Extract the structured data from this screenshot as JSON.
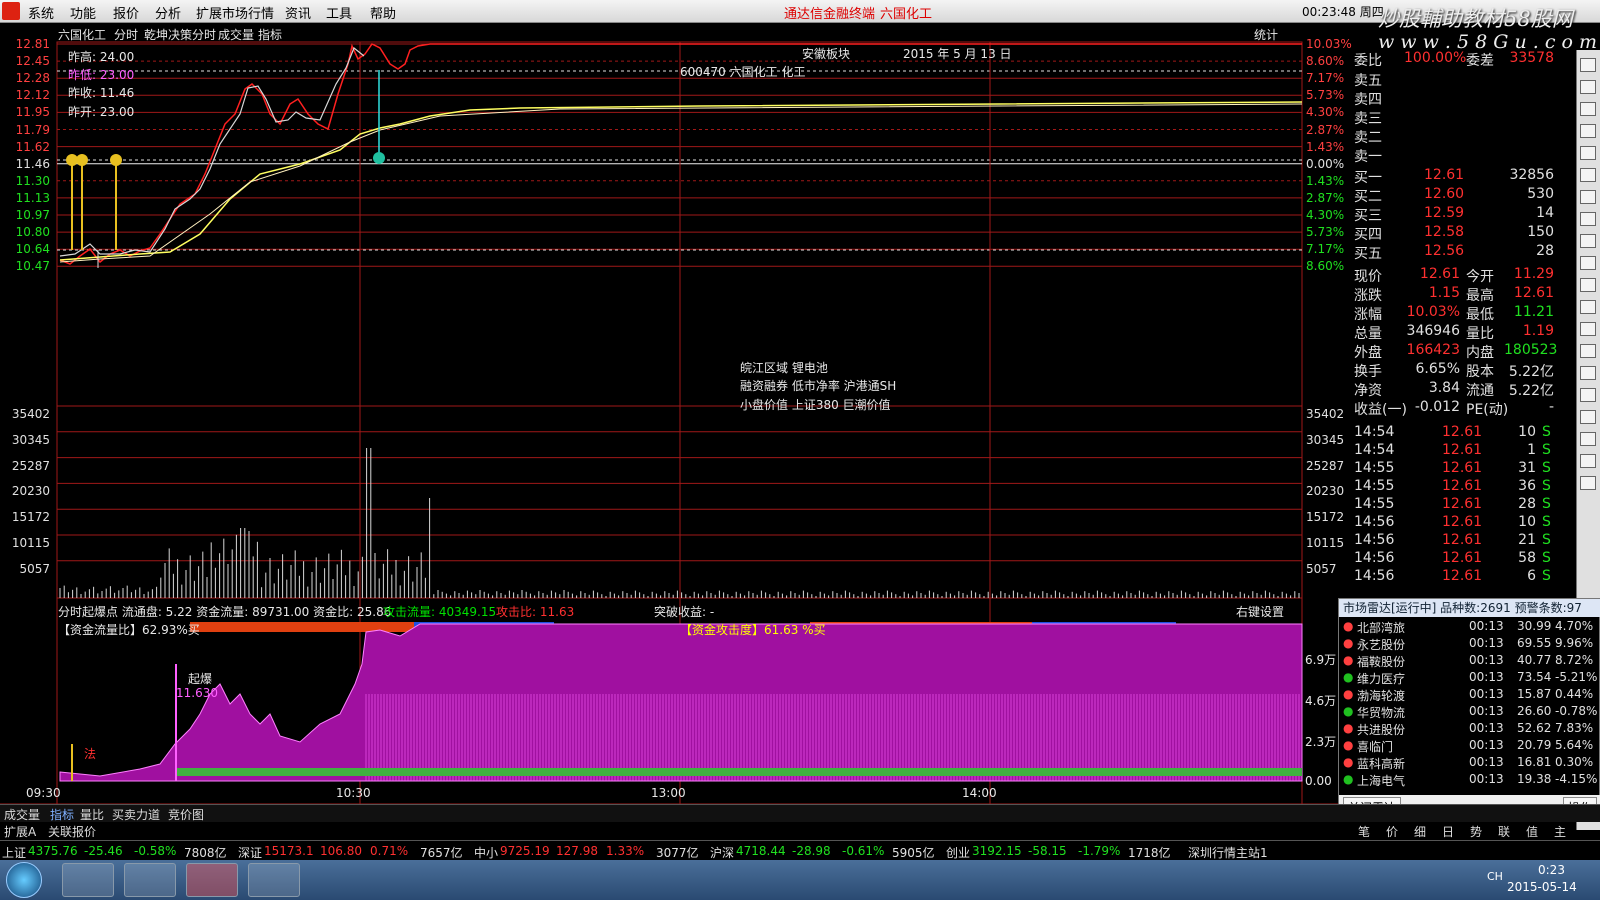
{
  "menu": {
    "items": [
      "系统",
      "功能",
      "报价",
      "分析",
      "扩展市场行情",
      "资讯",
      "工具",
      "帮助"
    ],
    "center_title": "通达信金融终端",
    "stock_title": "六国化工",
    "clock": "00:23:48 周四"
  },
  "watermark": {
    "line1": "炒股輔助教材58股网",
    "line2": "w w w . 5 8 G u . c o m"
  },
  "chart_header": {
    "stock": "六国化工",
    "tabs": [
      "分时",
      "乾坤决策分时",
      "成交量",
      "指标"
    ],
    "stat": "统计",
    "info_prev_high": "昨高: 24.00",
    "info_prev_low": "昨低: 23.00",
    "info_prev_close": "昨收: 11.46",
    "info_prev_open": "昨开: 23.00",
    "sector": "安徽板块",
    "date": "2015 年 5 月 13 日",
    "code_line": "600470    六国化工    化工",
    "tags": [
      "皖江区域 锂电池",
      "融资融券 低市净率 沪港通SH",
      "小盘价值 上证380 巨潮价值"
    ]
  },
  "price_axis": {
    "left": [
      "12.81",
      "12.45",
      "12.28",
      "12.12",
      "11.95",
      "11.79",
      "11.62",
      "11.46",
      "11.30",
      "11.13",
      "10.97",
      "10.80",
      "10.64",
      "10.47"
    ],
    "right": [
      "10.03%",
      "8.60%",
      "7.17%",
      "5.73%",
      "4.30%",
      "2.87%",
      "1.43%",
      "0.00%",
      "1.43%",
      "2.87%",
      "4.30%",
      "5.73%",
      "7.17%",
      "8.60%"
    ]
  },
  "vol_axis": [
    "35402",
    "30345",
    "25287",
    "20230",
    "15172",
    "10115",
    "5057"
  ],
  "lower_panel": {
    "title_prefix": "分时起爆点 流通盘: 5.22 资金流量: 89731.00 资金比: 25.86",
    "attack_flow": "攻击流量: 40349.15",
    "attack_ratio": "攻击比: 11.63",
    "breakout_gain": "突破收益: -",
    "right_setting": "右键设置",
    "bar1_label": "【资金流量比】62.93%买",
    "bar2_label": "【资金攻击度】61.63 %买",
    "qibao_label": "起爆",
    "qibao_price": "11.630",
    "fa_label": "法",
    "axis": [
      "6.9万",
      "4.6万",
      "2.3万",
      "0.00"
    ]
  },
  "time_axis": [
    "09:30",
    "10:30",
    "13:00",
    "14:00"
  ],
  "quote": {
    "weibi_label": "委比",
    "weibi_val": "100.00%",
    "weicha_label": "委差",
    "weicha_val": "33578",
    "sells": [
      "卖五",
      "卖四",
      "卖三",
      "卖二",
      "卖一"
    ],
    "buys": [
      {
        "label": "买一",
        "price": "12.61",
        "vol": "32856"
      },
      {
        "label": "买二",
        "price": "12.60",
        "vol": "530"
      },
      {
        "label": "买三",
        "price": "12.59",
        "vol": "14"
      },
      {
        "label": "买四",
        "price": "12.58",
        "vol": "150"
      },
      {
        "label": "买五",
        "price": "12.56",
        "vol": "28"
      }
    ],
    "stats": [
      {
        "l1": "现价",
        "v1": "12.61",
        "l2": "今开",
        "v2": "11.29"
      },
      {
        "l1": "涨跌",
        "v1": "1.15",
        "l2": "最高",
        "v2": "12.61"
      },
      {
        "l1": "涨幅",
        "v1": "10.03%",
        "l2": "最低",
        "v2": "11.21"
      },
      {
        "l1": "总量",
        "v1": "346946",
        "l2": "量比",
        "v2": "1.19"
      },
      {
        "l1": "外盘",
        "v1": "166423",
        "l2": "内盘",
        "v2": "180523"
      },
      {
        "l1": "换手",
        "v1": "6.65%",
        "l2": "股本",
        "v2": "5.22亿"
      },
      {
        "l1": "净资",
        "v1": "3.84",
        "l2": "流通",
        "v2": "5.22亿"
      },
      {
        "l1": "收益(一)",
        "v1": "-0.012",
        "l2": "PE(动)",
        "v2": "-"
      }
    ],
    "ticks": [
      {
        "t": "14:54",
        "p": "12.61",
        "v": "10",
        "s": "S"
      },
      {
        "t": "14:54",
        "p": "12.61",
        "v": "1",
        "s": "S"
      },
      {
        "t": "14:55",
        "p": "12.61",
        "v": "31",
        "s": "S"
      },
      {
        "t": "14:55",
        "p": "12.61",
        "v": "36",
        "s": "S"
      },
      {
        "t": "14:55",
        "p": "12.61",
        "v": "28",
        "s": "S"
      },
      {
        "t": "14:56",
        "p": "12.61",
        "v": "10",
        "s": "S"
      },
      {
        "t": "14:56",
        "p": "12.61",
        "v": "21",
        "s": "S"
      },
      {
        "t": "14:56",
        "p": "12.61",
        "v": "58",
        "s": "S"
      },
      {
        "t": "14:56",
        "p": "12.61",
        "v": "6",
        "s": "S"
      }
    ]
  },
  "radar": {
    "header": "市场雷达[运行中] 品种数:2691 预警条数:97",
    "rows": [
      {
        "name": "北部湾旅",
        "time": "00:13",
        "price": "30.99",
        "pct": "4.70%"
      },
      {
        "name": "永艺股份",
        "time": "00:13",
        "price": "69.55",
        "pct": "9.96%"
      },
      {
        "name": "福鞍股份",
        "time": "00:13",
        "price": "40.77",
        "pct": "8.72%"
      },
      {
        "name": "维力医疗",
        "time": "00:13",
        "price": "73.54",
        "pct": "-5.21%"
      },
      {
        "name": "渤海轮渡",
        "time": "00:13",
        "price": "15.87",
        "pct": "0.44%"
      },
      {
        "name": "华贸物流",
        "time": "00:13",
        "price": "26.60",
        "pct": "-0.78%"
      },
      {
        "name": "共进股份",
        "time": "00:13",
        "price": "52.62",
        "pct": "7.83%"
      },
      {
        "name": "喜临门",
        "time": "00:13",
        "price": "20.79",
        "pct": "5.64%"
      },
      {
        "name": "蓝科高新",
        "time": "00:13",
        "price": "16.81",
        "pct": "0.30%"
      },
      {
        "name": "上海电气",
        "time": "00:13",
        "price": "19.38",
        "pct": "-4.15%"
      }
    ],
    "close_btn": "关闭雷达",
    "op_btn": "操作",
    "tabs": [
      "笔",
      "价",
      "细",
      "日",
      "势",
      "联",
      "值",
      "主"
    ]
  },
  "bottom_tabs": [
    "成交量",
    "指标",
    "量比",
    "买卖力道",
    "竞价图"
  ],
  "bottom_tabs2": [
    "扩展A",
    "关联报价"
  ],
  "index_bar": [
    {
      "name": "上证",
      "val": "4375.76",
      "chg": "-25.46",
      "pct": "-0.58%",
      "amt": "7808亿"
    },
    {
      "name": "深证",
      "val": "15173.1",
      "chg": "106.80",
      "pct": "0.71%",
      "amt": "7657亿"
    },
    {
      "name": "中小",
      "val": "9725.19",
      "chg": "127.98",
      "pct": "1.33%",
      "amt": "3077亿"
    },
    {
      "name": "沪深",
      "val": "4718.44",
      "chg": "-28.98",
      "pct": "-0.61%",
      "amt": "5905亿"
    },
    {
      "name": "创业",
      "val": "3192.15",
      "chg": "-58.15",
      "pct": "-1.79%",
      "amt": "1718亿"
    }
  ],
  "index_server": "深圳行情主站1",
  "taskbar": {
    "time": "0:23",
    "date": "2015-05-14",
    "lang": "CH"
  }
}
